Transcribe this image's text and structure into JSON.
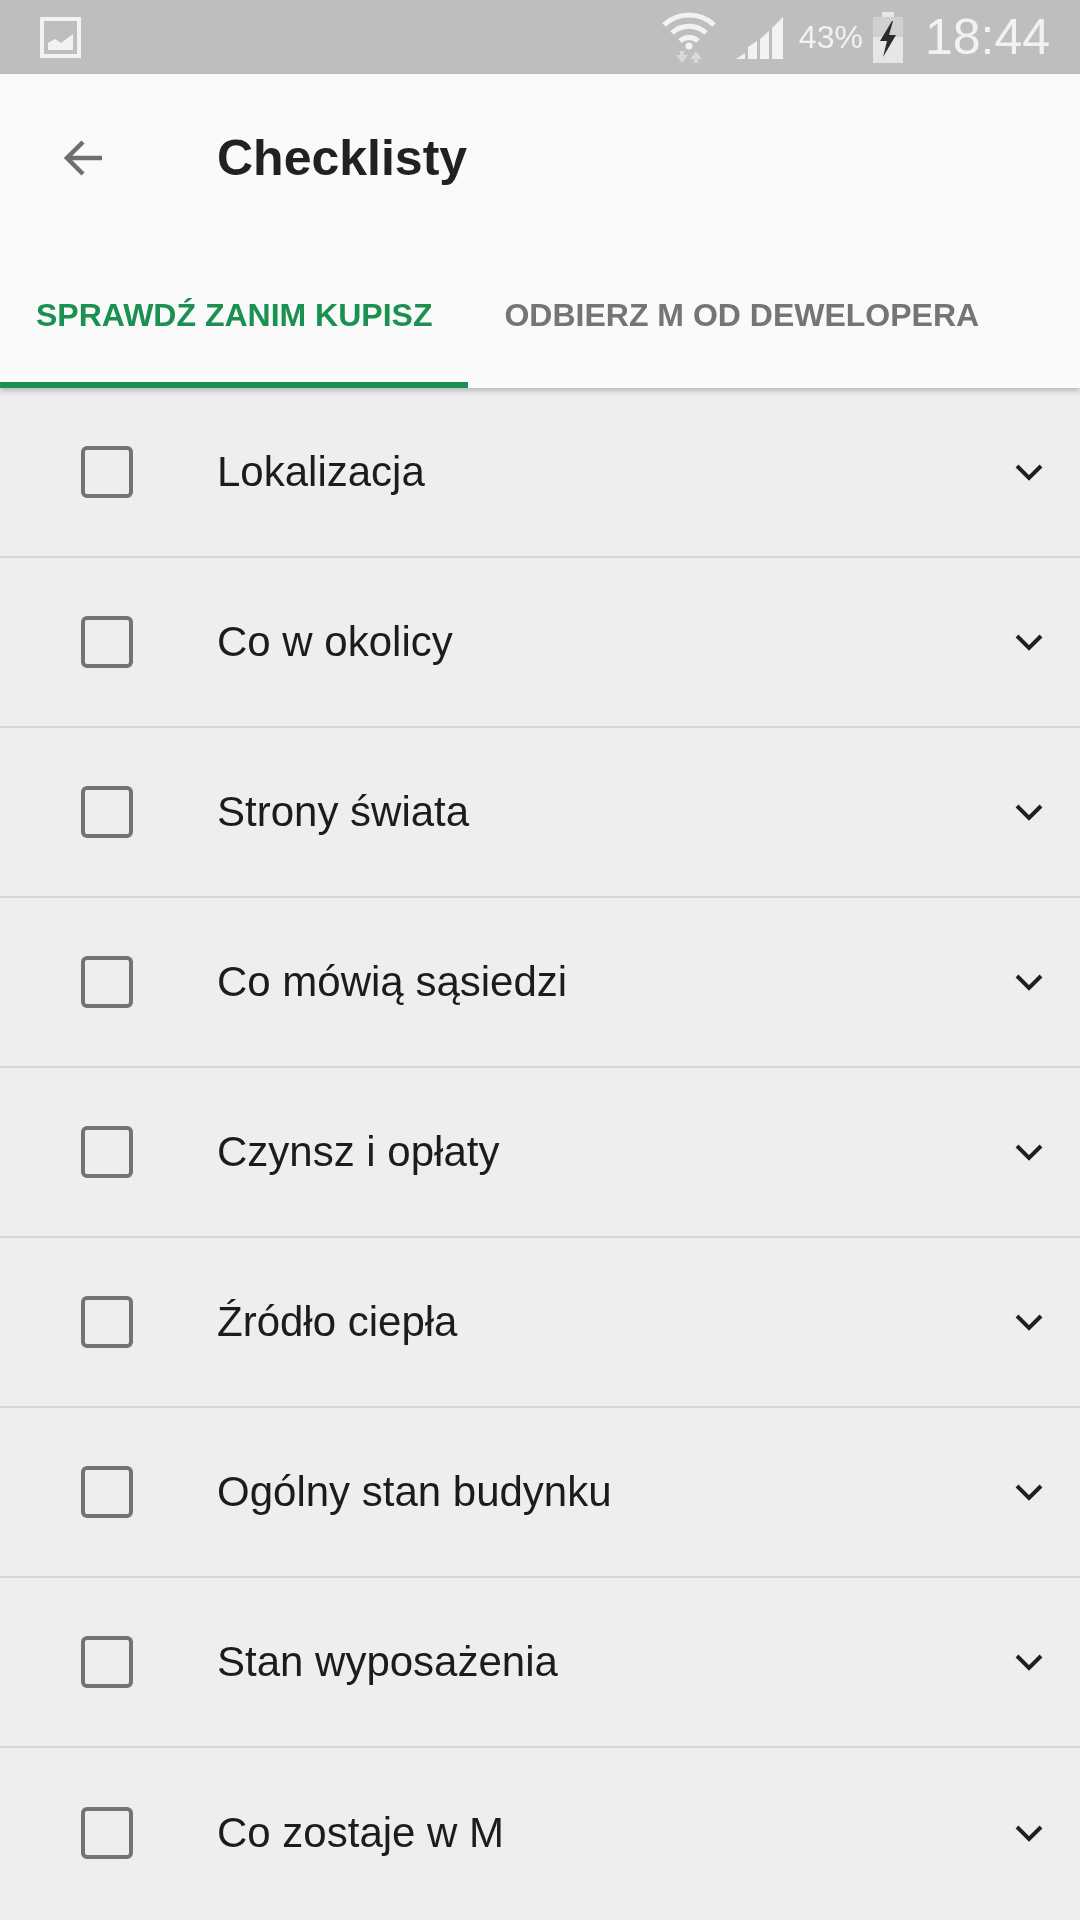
{
  "status_bar": {
    "battery": "43%",
    "time": "18:44"
  },
  "app_bar": {
    "title": "Checklisty"
  },
  "tabs": [
    {
      "label": "SPRAWDŹ ZANIM KUPISZ",
      "selected": true
    },
    {
      "label": "ODBIERZ M OD DEWELOPERA",
      "selected": false
    }
  ],
  "checklist": [
    {
      "label": "Lokalizacja",
      "checked": false,
      "expanded": false
    },
    {
      "label": "Co w okolicy",
      "checked": false,
      "expanded": false
    },
    {
      "label": "Strony świata",
      "checked": false,
      "expanded": false
    },
    {
      "label": "Co mówią sąsiedzi",
      "checked": false,
      "expanded": false
    },
    {
      "label": "Czynsz i opłaty",
      "checked": false,
      "expanded": false
    },
    {
      "label": "Źródło ciepła",
      "checked": false,
      "expanded": false
    },
    {
      "label": "Ogólny stan budynku",
      "checked": false,
      "expanded": false
    },
    {
      "label": "Stan wyposażenia",
      "checked": false,
      "expanded": false
    },
    {
      "label": "Co zostaje w M",
      "checked": false,
      "expanded": false
    }
  ]
}
